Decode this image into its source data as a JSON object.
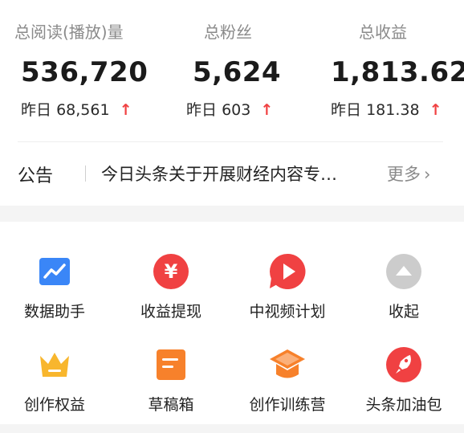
{
  "stats": [
    {
      "label": "总阅读(播放)量",
      "value": "536,720",
      "delta_prefix": "昨日",
      "delta": "68,561",
      "arrow": "↑"
    },
    {
      "label": "总粉丝",
      "value": "5,624",
      "delta_prefix": "昨日",
      "delta": "603",
      "arrow": "↑"
    },
    {
      "label": "总收益",
      "value": "1,813.62",
      "delta_prefix": "昨日",
      "delta": "181.38",
      "arrow": "↑"
    }
  ],
  "notice": {
    "label": "公告",
    "text": "今日头条关于开展财经内容专…",
    "more": "更多",
    "chevron": "›"
  },
  "tools": [
    {
      "label": "数据助手",
      "icon": "data-assistant-icon",
      "color": "#3a86f7"
    },
    {
      "label": "收益提现",
      "icon": "yuan-withdraw-icon",
      "color": "#f04142",
      "glyph": "¥"
    },
    {
      "label": "中视频计划",
      "icon": "video-plan-icon",
      "color": "#f04142"
    },
    {
      "label": "收起",
      "icon": "collapse-icon",
      "color": "#cccccc"
    },
    {
      "label": "创作权益",
      "icon": "crown-icon",
      "color": "#f8b62d"
    },
    {
      "label": "草稿箱",
      "icon": "draft-box-icon",
      "color": "#f7812b"
    },
    {
      "label": "创作训练营",
      "icon": "graduation-cap-icon",
      "color": "#f7812b"
    },
    {
      "label": "头条加油包",
      "icon": "rocket-icon",
      "color": "#f04142"
    }
  ],
  "colors": {
    "accent_red": "#f04142",
    "muted_text": "#8a8a8a"
  }
}
